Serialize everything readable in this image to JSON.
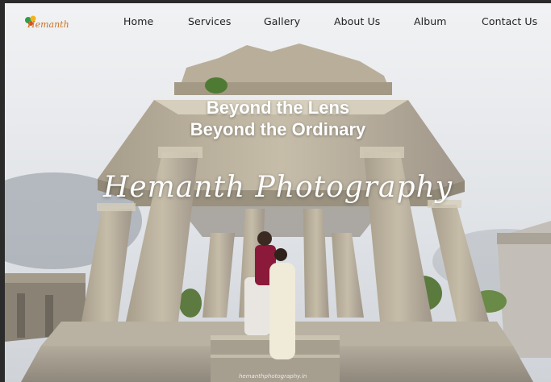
{
  "logo": {
    "text": "Hemanth"
  },
  "nav": {
    "items": [
      {
        "label": "Home"
      },
      {
        "label": "Services"
      },
      {
        "label": "Gallery"
      },
      {
        "label": "About Us"
      },
      {
        "label": "Album"
      },
      {
        "label": "Contact Us"
      }
    ]
  },
  "hero": {
    "tagline_line1": "Beyond the Lens",
    "tagline_line2": "Beyond the Ordinary",
    "brand": "Hemanth Photography",
    "watermark": "hemanthphotography.in"
  },
  "colors": {
    "nav_text": "#1f1f1f",
    "hero_text": "#ffffff",
    "stone": "#b5ab99",
    "sky": "#e4e7ea"
  }
}
